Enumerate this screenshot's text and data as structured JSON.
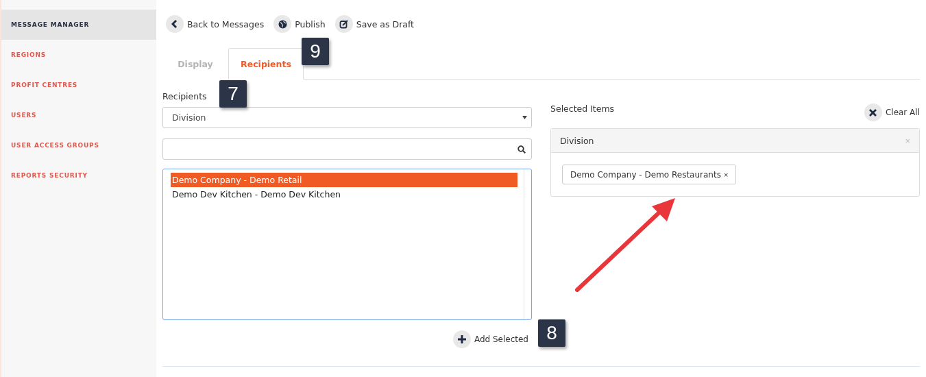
{
  "sidebar": {
    "items": [
      {
        "label": "MESSAGE MANAGER",
        "selected": true
      },
      {
        "label": "REGIONS",
        "selected": false
      },
      {
        "label": "PROFIT CENTRES",
        "selected": false
      },
      {
        "label": "USERS",
        "selected": false
      },
      {
        "label": "USER ACCESS GROUPS",
        "selected": false
      },
      {
        "label": "REPORTS SECURITY",
        "selected": false
      }
    ]
  },
  "toolbar": [
    {
      "kind": "back",
      "label": "Back to Messages"
    },
    {
      "kind": "publish",
      "label": "Publish"
    },
    {
      "kind": "draft",
      "label": "Save as Draft"
    }
  ],
  "tabs": [
    {
      "label": "Display",
      "selected": false
    },
    {
      "label": "Recipients",
      "selected": true
    }
  ],
  "recipients": {
    "label": "Recipients",
    "select_value": "Division",
    "options": [
      {
        "label": "Demo Company - Demo Retail",
        "selected": true
      },
      {
        "label": "Demo Dev Kitchen - Demo Dev Kitchen",
        "selected": false
      }
    ],
    "add_button": "Add Selected"
  },
  "selected_items": {
    "title": "Selected Items",
    "clear_all": "Clear All",
    "group": {
      "title": "Division",
      "close": "×",
      "tags": [
        {
          "label": "Demo Company - Demo Restaurants",
          "remove": "×"
        }
      ]
    }
  },
  "callouts": [
    {
      "number": "9"
    },
    {
      "number": "7"
    },
    {
      "number": "8"
    }
  ]
}
